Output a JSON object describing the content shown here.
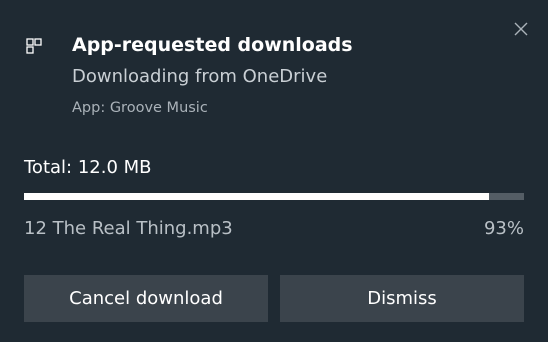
{
  "notification": {
    "title": "App-requested downloads",
    "subtitle": "Downloading from OneDrive",
    "app_label": "App: Groove Music",
    "close_icon": "close-icon",
    "app_icon": "app-tiles-icon"
  },
  "download": {
    "total_label": "Total: 12.0 MB",
    "file_name": "12 The Real Thing.mp3",
    "percent_label": "93%",
    "progress_fraction": 0.93
  },
  "actions": {
    "cancel_label": "Cancel download",
    "dismiss_label": "Dismiss"
  },
  "colors": {
    "background": "#1f2a33",
    "button_bg": "#3b444c",
    "progress_track": "#545d65",
    "progress_fill": "#ffffff"
  }
}
